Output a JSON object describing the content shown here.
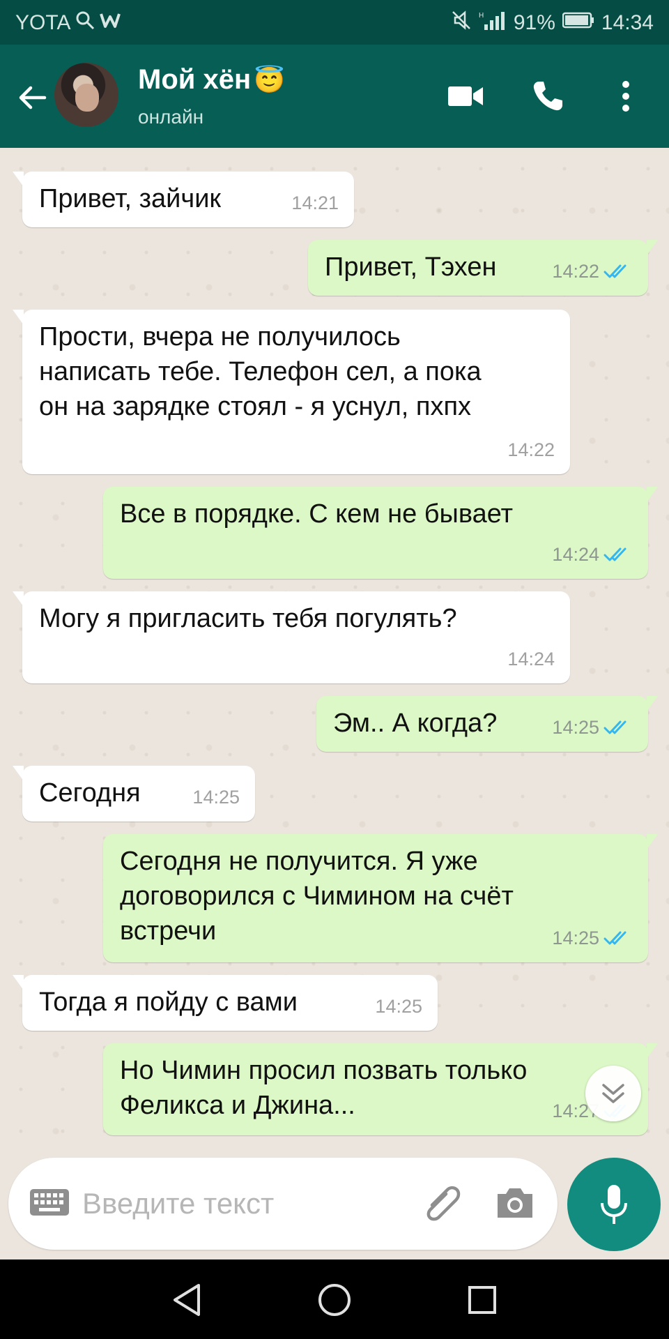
{
  "status_bar": {
    "carrier": "YOTA",
    "battery": "91%",
    "time": "14:34",
    "icons": [
      "search-icon",
      "w-icon",
      "mute-icon",
      "signal-icon",
      "battery-icon"
    ]
  },
  "header": {
    "contact_name": "Мой хён",
    "emoji": "😇",
    "status": "онлайн",
    "actions": [
      "video-call-icon",
      "phone-icon",
      "more-icon"
    ]
  },
  "messages": [
    {
      "dir": "in",
      "text": "Привет, зайчик",
      "time": "14:21"
    },
    {
      "dir": "out",
      "text": "Привет, Тэхен",
      "time": "14:22",
      "read": true
    },
    {
      "dir": "in",
      "text": "Прости, вчера не получилось\nнаписать тебе. Телефон сел, а пока\nон на зарядке стоял - я уснул, пхпх",
      "time": "14:22"
    },
    {
      "dir": "out",
      "text": "Все в порядке. С кем не бывает",
      "time": "14:24",
      "read": true
    },
    {
      "dir": "in",
      "text": "Могу я пригласить тебя погулять?",
      "time": "14:24"
    },
    {
      "dir": "out",
      "text": "Эм.. А когда?",
      "time": "14:25",
      "read": true
    },
    {
      "dir": "in",
      "text": "Сегодня",
      "time": "14:25"
    },
    {
      "dir": "out",
      "text": "Сегодня не получится. Я уже\nдоговорился с Чимином на счёт\nвстречи",
      "time": "14:25",
      "read": true
    },
    {
      "dir": "in",
      "text": "Тогда я пойду с вами",
      "time": "14:25"
    },
    {
      "dir": "out",
      "text": "Но Чимин просил позвать только\nФеликса и Джина...",
      "time": "14:27",
      "read": true
    }
  ],
  "composer": {
    "placeholder": "Введите текст"
  },
  "colors": {
    "header": "#075e54",
    "status_bar": "#054d44",
    "incoming_bubble": "#ffffff",
    "outgoing_bubble": "#dcf8c6",
    "read_ticks": "#34b7f1",
    "mic_button": "#128c7e",
    "chat_background": "#ece5dd"
  }
}
